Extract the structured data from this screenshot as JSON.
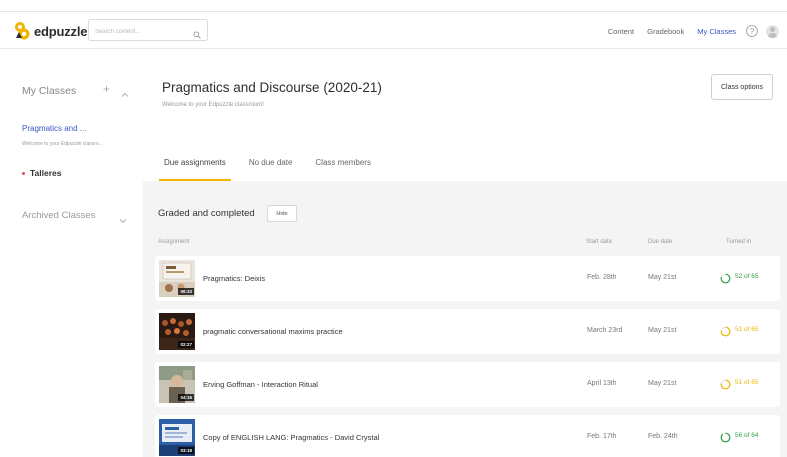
{
  "header": {
    "logo_text": "edpuzzle",
    "search_placeholder": "Search content...",
    "nav": [
      {
        "label": "Content",
        "active": false
      },
      {
        "label": "Gradebook",
        "active": false
      },
      {
        "label": "My Classes",
        "active": true
      }
    ],
    "help_label": "?"
  },
  "sidebar": {
    "title": "My Classes",
    "add_label": "+",
    "classes": [
      {
        "label": "Pragmatics and ...",
        "subtitle": "Welcome to your Edpuzzle classro..."
      },
      {
        "label": "Talleres"
      }
    ],
    "archived_label": "Archived Classes"
  },
  "main": {
    "class_title": "Pragmatics and Discourse (2020-21)",
    "welcome": "Welcome to your Edpuzzle classroom!",
    "class_options_label": "Class options",
    "tabs": [
      {
        "label": "Due assignments",
        "active": true
      },
      {
        "label": "No due date",
        "active": false
      },
      {
        "label": "Class members",
        "active": false
      }
    ],
    "section_title": "Graded and completed",
    "hide_label": "Hide",
    "columns": {
      "assignment": "Assignment",
      "start_date": "Start date",
      "due_date": "Due date",
      "turned_in": "Turned in"
    },
    "assignments": [
      {
        "title": "Pragmatics: Deixis",
        "duration": "06:33",
        "start": "Feb. 28th",
        "due": "May 21st",
        "turned_in": "52 of 65",
        "fraction": 0.8,
        "color": "#2e9e44"
      },
      {
        "title": "pragmatic conversational maxims practice",
        "duration": "02:27",
        "start": "March 23rd",
        "due": "May 21st",
        "turned_in": "51 of 65",
        "fraction": 0.78,
        "color": "#f2b400"
      },
      {
        "title": "Erving Goffman - Interaction Ritual",
        "duration": "04:16",
        "start": "April 13th",
        "due": "May 21st",
        "turned_in": "51 of 65",
        "fraction": 0.78,
        "color": "#f2b400"
      },
      {
        "title": "Copy of ENGLISH LANG: Pragmatics - David Crystal",
        "duration": "03:18",
        "start": "Feb. 17th",
        "due": "Feb. 24th",
        "turned_in": "56 of 64",
        "fraction": 0.875,
        "color": "#2e9e44"
      }
    ]
  },
  "colors": {
    "accent_blue": "#3a57c4",
    "tab_underline": "#f2b400",
    "green": "#2e9e44",
    "yellow": "#f2b400"
  }
}
